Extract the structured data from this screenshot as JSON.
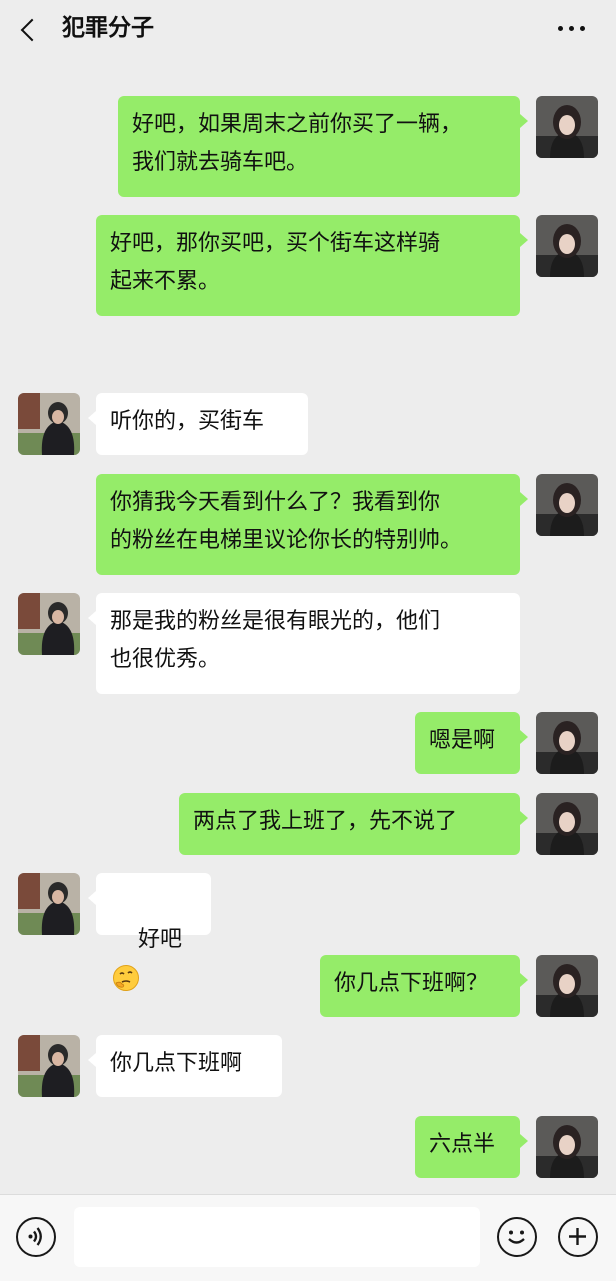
{
  "header": {
    "back_icon": "chevron-left-icon",
    "title": "犯罪分子",
    "more_icon": "more-dots-icon"
  },
  "messages": [
    {
      "side": "right",
      "text": "好吧，如果周末之前你买了一辆，\n我们就去骑车吧。"
    },
    {
      "side": "right",
      "text": "好吧，那你买吧，买个街车这样骑\n起来不累。"
    },
    {
      "side": "left",
      "text": "听你的，买街车"
    },
    {
      "side": "right",
      "text": "你猜我今天看到什么了？我看到你\n的粉丝在电梯里议论你长的特别帅。"
    },
    {
      "side": "left",
      "text": "那是我的粉丝是很有眼光的，他们\n也很优秀。"
    },
    {
      "side": "right",
      "text": "嗯是啊"
    },
    {
      "side": "right",
      "text": "两点了我上班了，先不说了"
    },
    {
      "side": "left",
      "text": "好吧",
      "emoji": "thinking-face-emoji"
    },
    {
      "side": "right",
      "text": "你几点下班啊？"
    },
    {
      "side": "left",
      "text": "你几点下班啊"
    },
    {
      "side": "right",
      "text": "六点半"
    }
  ],
  "input_bar": {
    "voice_icon": "voice-icon",
    "text_value": "",
    "emoji_icon": "smiley-icon",
    "plus_icon": "plus-circle-icon"
  },
  "colors": {
    "background": "#ededed",
    "self_bubble": "#95ec69",
    "other_bubble": "#ffffff"
  }
}
